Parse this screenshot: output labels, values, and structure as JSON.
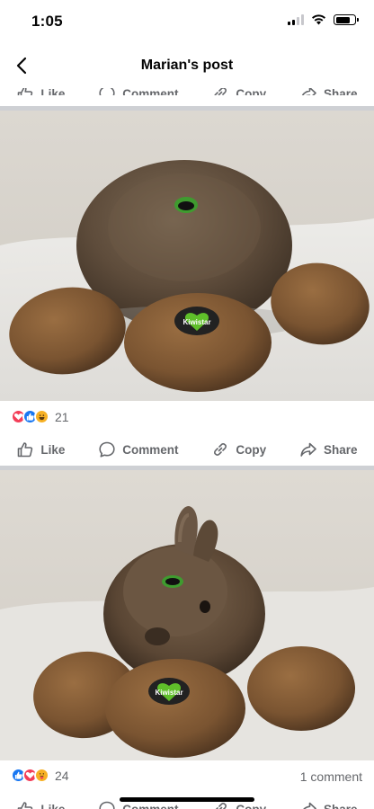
{
  "status_bar": {
    "time": "1:05"
  },
  "header": {
    "title": "Marian's post"
  },
  "actions": {
    "like": "Like",
    "comment": "Comment",
    "copy": "Copy",
    "share": "Share"
  },
  "posts": [
    {
      "sticker_text": "Kiwistar",
      "reactions": [
        "love",
        "like",
        "haha"
      ],
      "reaction_count": "21"
    },
    {
      "sticker_text": "Kiwistar",
      "reactions": [
        "like",
        "love",
        "care"
      ],
      "reaction_count": "24",
      "comments_label": "1 comment"
    }
  ],
  "colors": {
    "like": "#1877f2",
    "love": "#f33e58",
    "haha": "#f7b125",
    "divider": "#ced0d4",
    "muted": "#65676b"
  }
}
